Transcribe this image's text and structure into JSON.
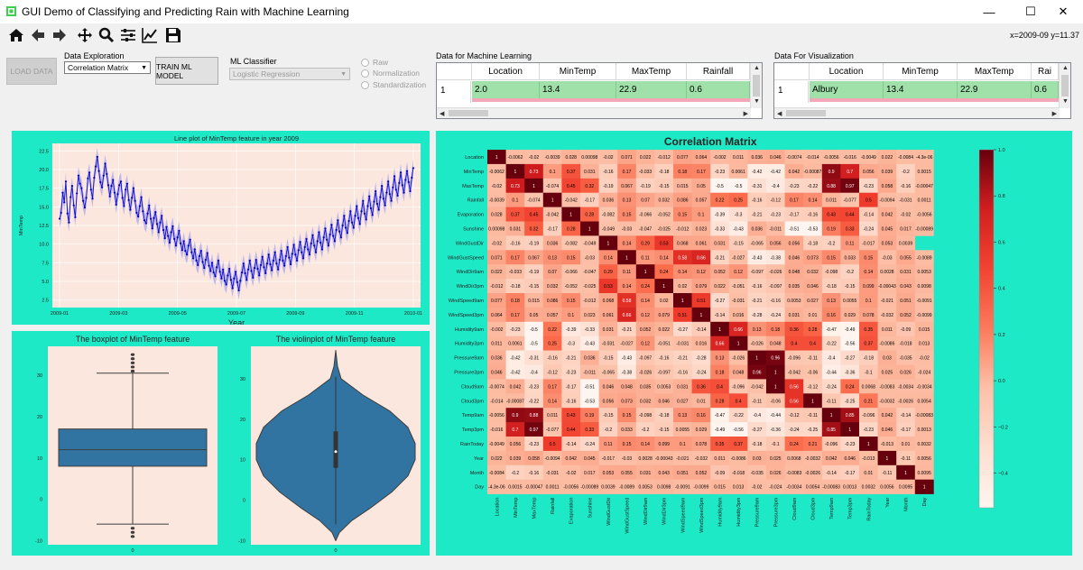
{
  "window": {
    "title": "GUI Demo of Classifying and Predicting Rain with Machine Learning",
    "minimize": "—",
    "maximize": "☐",
    "close": "✕"
  },
  "toolbar": {
    "items": [
      {
        "name": "home-icon",
        "glyph": "⌂"
      },
      {
        "name": "back-icon",
        "glyph": "←"
      },
      {
        "name": "forward-icon",
        "glyph": "→"
      },
      {
        "name": "pan-icon",
        "glyph": "✥"
      },
      {
        "name": "zoom-icon",
        "glyph": "⚲"
      },
      {
        "name": "configure-subplots-icon",
        "glyph": "☰"
      },
      {
        "name": "edit-axis-icon",
        "glyph": "📈"
      },
      {
        "name": "save-icon",
        "glyph": "💾"
      }
    ],
    "coords": "x=2009-09 y=11.37"
  },
  "controls": {
    "load_data": "LOAD DATA",
    "data_exploration_label": "Data Exploration",
    "data_exploration_value": "Correlation Matrix",
    "train_button": "TRAIN ML MODEL",
    "ml_classifier_label": "ML Classifier",
    "ml_classifier_value": "Logistic Regression",
    "radios": [
      "Raw",
      "Normalization",
      "Standardization"
    ]
  },
  "ml_table": {
    "title": "Data for Machine Learning",
    "columns": [
      "Location",
      "MinTemp",
      "MaxTemp",
      "Rainfall"
    ],
    "row_header": "1",
    "row": [
      "2.0",
      "13.4",
      "22.9",
      "0.6"
    ]
  },
  "vis_table": {
    "title": "Data For Visualization",
    "columns": [
      "Location",
      "MinTemp",
      "MaxTemp",
      "Rai"
    ],
    "row_header": "1",
    "row": [
      "Albury",
      "13.4",
      "22.9",
      "0.6"
    ]
  },
  "line_chart_data": {
    "type": "line",
    "title": "Line plot of MinTemp feature in year 2009",
    "xlabel": "Year",
    "ylabel": "MinTemp",
    "xticks": [
      "2009-01",
      "2009-03",
      "2009-05",
      "2009-07",
      "2009-09",
      "2009-11",
      "2010-01"
    ],
    "yticks": [
      "2.5",
      "5.0",
      "7.5",
      "10.0",
      "12.5",
      "15.0",
      "17.5",
      "20.0",
      "22.5"
    ],
    "ylim": [
      1.5,
      23.5
    ],
    "values": [
      13.4,
      14.2,
      16.9,
      15.6,
      18.4,
      14.1,
      12.9,
      16.3,
      17.8,
      15.2,
      13.6,
      16.8,
      19.2,
      18.1,
      17.5,
      15.8,
      14.9,
      16.2,
      18.8,
      19.6,
      17.3,
      16.1,
      18.9,
      20.4,
      21.7,
      19.8,
      18.3,
      17.6,
      19.2,
      20.8,
      19.4,
      17.9,
      16.4,
      17.8,
      18.6,
      16.9,
      15.3,
      16.7,
      17.9,
      18.4,
      16.2,
      15.1,
      17.3,
      18.1,
      15.9,
      14.6,
      16.2,
      17.5,
      15.8,
      14.2,
      13.7,
      15.1,
      16.3,
      14.4,
      13.2,
      12.8,
      14.1,
      15.2,
      13.4,
      12.1,
      13.5,
      14.3,
      12.7,
      11.6,
      12.9,
      13.8,
      11.9,
      10.8,
      12.3,
      11.1,
      10.2,
      11.6,
      12.4,
      10.7,
      9.8,
      10.9,
      11.8,
      10.1,
      9.2,
      10.4,
      9.1,
      8.6,
      9.8,
      10.6,
      8.9,
      8.1,
      9.3,
      7.8,
      7.2,
      8.4,
      9.1,
      7.6,
      6.8,
      7.9,
      8.8,
      7.1,
      6.4,
      7.5,
      6.2,
      5.7,
      6.9,
      7.8,
      6.3,
      5.4,
      6.6,
      5.1,
      4.6,
      5.8,
      6.7,
      5.2,
      4.1,
      5.4,
      6.3,
      4.9,
      3.8,
      5.1,
      6.2,
      7.4,
      6.1,
      5.2,
      6.6,
      7.8,
      6.4,
      5.5,
      6.8,
      7.9,
      6.7,
      5.8,
      7.2,
      8.3,
      6.9,
      6.1,
      7.4,
      8.6,
      7.3,
      6.5,
      7.8,
      8.9,
      7.4,
      6.6,
      7.9,
      9.1,
      7.8,
      7.1,
      8.4,
      9.6,
      8.2,
      7.3,
      8.7,
      9.9,
      8.6,
      7.8,
      9.2,
      10.3,
      8.9,
      8.1,
      9.6,
      10.7,
      9.3,
      8.6,
      10.1,
      11.2,
      9.8,
      8.9,
      10.4,
      11.6,
      10.2,
      9.3,
      10.9,
      12.1,
      10.6,
      9.8,
      11.3,
      12.6,
      11.1,
      10.4,
      11.9,
      13.2,
      11.7,
      10.9,
      12.5,
      13.8,
      12.2,
      11.5,
      13.1,
      14.4,
      12.9,
      12.2,
      13.8,
      15.1,
      13.5,
      12.7,
      14.4,
      15.8,
      14.1,
      13.3,
      15.1,
      16.4,
      14.8,
      13.9,
      15.7,
      17.1,
      15.4,
      14.6,
      16.3,
      17.8,
      16.1,
      15.2,
      16.9,
      18.4,
      16.7,
      15.8,
      17.6,
      19.1,
      17.3,
      16.5,
      18.2,
      19.6,
      17.9,
      16.9,
      18.6,
      19.8,
      18.3,
      17.1,
      18.9,
      20.2
    ]
  },
  "box_chart_data": {
    "type": "box",
    "title": "The boxplot of MinTemp feature",
    "xticks": [
      "0"
    ],
    "yticks": [
      "-10",
      "0",
      "10",
      "20",
      "30"
    ],
    "ylim": [
      -11,
      37
    ],
    "whisker_low": -6,
    "q1": 8,
    "median": 12,
    "q3": 17,
    "whisker_high": 30.5,
    "outliers": [
      31,
      32,
      33,
      34,
      35,
      -7,
      -8,
      -9
    ]
  },
  "violin_chart_data": {
    "type": "violin",
    "title": "The violinplot of MinTemp feature",
    "xticks": [
      "0"
    ],
    "yticks": [
      "-10",
      "0",
      "10",
      "20",
      "30"
    ],
    "ylim": [
      -11,
      38
    ]
  },
  "corr_chart_data": {
    "type": "heatmap",
    "title": "Correlation Matrix",
    "labels": [
      "Location",
      "MinTemp",
      "MaxTemp",
      "Rainfall",
      "Evaporation",
      "Sunshine",
      "WindGustDir",
      "WindGustSpeed",
      "WindDir9am",
      "WindDir3pm",
      "WindSpeed9am",
      "WindSpeed3pm",
      "Humidity9am",
      "Humidity3pm",
      "Pressure9am",
      "Pressure3pm",
      "Cloud9am",
      "Cloud3pm",
      "Temp9am",
      "Temp3pm",
      "RainToday",
      "Year",
      "Month",
      "Day"
    ],
    "colorbar_ticks": [
      "1.0",
      "0.8",
      "0.6",
      "0.4",
      "0.2",
      "0.0",
      "−0.2",
      "−0.4"
    ],
    "matrix": [
      [
        "1",
        "-0.0062",
        "-0.02",
        "-0.0039",
        "0.028",
        "0.00098",
        "-0.02",
        "0.071",
        "0.022",
        "-0.012",
        "0.077",
        "0.064",
        "-0.002",
        "0.011",
        "0.036",
        "0.046",
        "-0.0074",
        "-0.014",
        "-0.0056",
        "-0.016",
        "-0.0049",
        "0.022",
        "-0.0084",
        "-4.3e-06"
      ],
      [
        "-0.0062",
        "1",
        "0.73",
        "0.1",
        "0.37",
        "0.031",
        "-0.16",
        "0.17",
        "-0.033",
        "-0.18",
        "0.18",
        "0.17",
        "-0.23",
        "0.0061",
        "-0.42",
        "-0.42",
        "0.042",
        "-0.00087",
        "0.9",
        "0.7",
        "0.056",
        "0.039",
        "-0.2",
        "0.0015"
      ],
      [
        "-0.02",
        "0.73",
        "1",
        "-0.074",
        "0.45",
        "0.32",
        "-0.19",
        "0.067",
        "-0.19",
        "-0.15",
        "0.015",
        "0.05",
        "-0.5",
        "-0.5",
        "-0.31",
        "-0.4",
        "-0.23",
        "-0.22",
        "0.88",
        "0.97",
        "-0.23",
        "0.058",
        "-0.16",
        "-0.00047"
      ],
      [
        "-0.0039",
        "0.1",
        "-0.074",
        "1",
        "-0.042",
        "-0.17",
        "0.036",
        "0.13",
        "0.07",
        "0.032",
        "0.086",
        "0.057",
        "0.22",
        "0.25",
        "-0.16",
        "-0.12",
        "0.17",
        "0.14",
        "0.011",
        "-0.077",
        "0.5",
        "-0.0094",
        "-0.031",
        "0.0011"
      ],
      [
        "0.028",
        "0.37",
        "0.45",
        "-0.042",
        "1",
        "0.28",
        "-0.082",
        "0.15",
        "-0.066",
        "-0.052",
        "0.15",
        "0.1",
        "-0.39",
        "-0.3",
        "-0.21",
        "-0.23",
        "-0.17",
        "-0.16",
        "0.43",
        "0.44",
        "-0.14",
        "0.042",
        "-0.02",
        "-0.0056"
      ],
      [
        "0.00098",
        "0.031",
        "0.32",
        "-0.17",
        "0.28",
        "1",
        "-0.049",
        "-0.03",
        "-0.047",
        "-0.025",
        "-0.012",
        "0.023",
        "-0.33",
        "-0.43",
        "0.036",
        "-0.011",
        "-0.51",
        "-0.53",
        "0.19",
        "0.33",
        "-0.24",
        "0.045",
        "0.017",
        "-0.00089"
      ],
      [
        "-0.02",
        "-0.16",
        "-0.19",
        "0.036",
        "-0.082",
        "-0.049",
        "1",
        "0.14",
        "0.29",
        "0.53",
        "0.068",
        "0.061",
        "0.031",
        "-0.15",
        "-0.065",
        "0.056",
        "0.056",
        "-0.18",
        "-0.2",
        "0.11",
        "-0.017",
        "0.053",
        "0.0039"
      ],
      [
        "0.071",
        "0.17",
        "0.067",
        "0.13",
        "0.15",
        "-0.03",
        "0.14",
        "1",
        "0.11",
        "0.14",
        "0.58",
        "0.66",
        "-0.21",
        "-0.027",
        "-0.43",
        "-0.38",
        "0.046",
        "0.073",
        "0.15",
        "0.033",
        "0.15",
        "-0.03",
        "0.055",
        "-0.0089"
      ],
      [
        "0.022",
        "-0.033",
        "-0.19",
        "0.07",
        "-0.066",
        "-0.047",
        "0.29",
        "0.11",
        "1",
        "0.24",
        "0.14",
        "0.12",
        "0.052",
        "0.12",
        "-0.097",
        "-0.026",
        "0.048",
        "0.032",
        "-0.098",
        "-0.2",
        "0.14",
        "0.0028",
        "0.031",
        "0.0053"
      ],
      [
        "-0.012",
        "-0.18",
        "-0.15",
        "0.032",
        "-0.052",
        "-0.025",
        "0.53",
        "0.14",
        "0.24",
        "1",
        "0.02",
        "0.079",
        "0.022",
        "-0.051",
        "-0.16",
        "-0.097",
        "0.035",
        "0.046",
        "-0.18",
        "-0.15",
        "0.099",
        "-0.00043",
        "0.043",
        "0.0098"
      ],
      [
        "0.077",
        "0.18",
        "0.015",
        "0.086",
        "0.15",
        "-0.012",
        "0.068",
        "0.58",
        "0.14",
        "0.02",
        "1",
        "0.51",
        "-0.27",
        "-0.031",
        "-0.21",
        "-0.16",
        "0.0053",
        "0.027",
        "0.13",
        "0.0055",
        "0.1",
        "-0.021",
        "0.051",
        "-0.0091"
      ],
      [
        "0.064",
        "0.17",
        "0.05",
        "0.057",
        "0.1",
        "0.023",
        "0.061",
        "0.66",
        "0.12",
        "0.079",
        "0.51",
        "1",
        "-0.14",
        "0.016",
        "-0.28",
        "-0.24",
        "0.031",
        "0.01",
        "0.16",
        "0.029",
        "0.078",
        "-0.032",
        "0.052",
        "-0.0099"
      ],
      [
        "-0.002",
        "-0.23",
        "-0.5",
        "0.22",
        "-0.39",
        "-0.33",
        "0.031",
        "-0.21",
        "0.052",
        "0.022",
        "-0.27",
        "-0.14",
        "1",
        "0.66",
        "0.13",
        "0.18",
        "0.36",
        "0.28",
        "-0.47",
        "-0.49",
        "0.35",
        "0.011",
        "-0.09",
        "0.015"
      ],
      [
        "0.011",
        "0.0061",
        "-0.5",
        "0.25",
        "-0.3",
        "-0.43",
        "-0.031",
        "-0.027",
        "0.12",
        "-0.051",
        "-0.031",
        "0.016",
        "0.66",
        "1",
        "-0.026",
        "0.048",
        "0.4",
        "0.4",
        "-0.22",
        "-0.56",
        "0.37",
        "-0.0086",
        "-0.018",
        "0.013"
      ],
      [
        "0.036",
        "-0.42",
        "-0.31",
        "-0.16",
        "-0.21",
        "0.036",
        "-0.15",
        "-0.43",
        "-0.097",
        "-0.16",
        "-0.21",
        "-0.28",
        "0.13",
        "-0.026",
        "1",
        "0.96",
        "-0.096",
        "-0.11",
        "-0.4",
        "-0.27",
        "-0.18",
        "0.03",
        "-0.035",
        "-0.02"
      ],
      [
        "0.046",
        "-0.42",
        "-0.4",
        "-0.12",
        "-0.23",
        "-0.011",
        "-0.065",
        "-0.38",
        "-0.026",
        "-0.097",
        "-0.16",
        "-0.24",
        "0.18",
        "0.048",
        "0.96",
        "1",
        "-0.042",
        "-0.06",
        "-0.44",
        "-0.36",
        "-0.1",
        "0.025",
        "0.026",
        "-0.024"
      ],
      [
        "-0.0074",
        "0.042",
        "-0.23",
        "0.17",
        "-0.17",
        "-0.51",
        "0.046",
        "0.048",
        "0.035",
        "0.0053",
        "0.031",
        "0.36",
        "0.4",
        "-0.096",
        "-0.042",
        "1",
        "0.56",
        "-0.12",
        "-0.24",
        "0.24",
        "0.0068",
        "-0.0083",
        "-0.0034",
        "-0.0034"
      ],
      [
        "-0.014",
        "-0.00087",
        "-0.22",
        "0.14",
        "-0.16",
        "-0.53",
        "0.056",
        "0.073",
        "0.032",
        "0.046",
        "0.027",
        "0.01",
        "0.28",
        "0.4",
        "-0.11",
        "-0.06",
        "0.56",
        "1",
        "-0.11",
        "-0.25",
        "0.21",
        "-0.0032",
        "-0.0026",
        "0.0054"
      ],
      [
        "-0.0056",
        "0.9",
        "0.88",
        "0.011",
        "0.43",
        "0.19",
        "-0.15",
        "0.15",
        "-0.098",
        "-0.18",
        "0.13",
        "0.16",
        "-0.47",
        "-0.22",
        "-0.4",
        "-0.44",
        "-0.12",
        "-0.11",
        "1",
        "0.85",
        "-0.096",
        "0.042",
        "-0.14",
        "-0.00083"
      ],
      [
        "-0.016",
        "0.7",
        "0.97",
        "-0.077",
        "0.44",
        "0.33",
        "-0.2",
        "0.033",
        "-0.2",
        "-0.15",
        "0.0055",
        "0.029",
        "-0.49",
        "-0.56",
        "-0.27",
        "-0.36",
        "-0.24",
        "-0.25",
        "0.85",
        "1",
        "-0.23",
        "0.046",
        "-0.17",
        "0.0013"
      ],
      [
        "-0.0049",
        "0.056",
        "-0.23",
        "0.5",
        "-0.14",
        "-0.24",
        "0.11",
        "0.15",
        "0.14",
        "0.099",
        "0.1",
        "0.078",
        "0.35",
        "0.37",
        "-0.18",
        "-0.1",
        "0.24",
        "0.21",
        "-0.096",
        "-0.23",
        "1",
        "-0.013",
        "0.01",
        "0.0032"
      ],
      [
        "0.022",
        "0.039",
        "0.058",
        "-0.0094",
        "0.042",
        "0.045",
        "-0.017",
        "-0.03",
        "0.0028",
        "-0.00043",
        "-0.021",
        "-0.032",
        "0.011",
        "-0.0086",
        "0.03",
        "0.025",
        "0.0068",
        "-0.0032",
        "0.042",
        "0.046",
        "-0.013",
        "1",
        "-0.11",
        "0.0056"
      ],
      [
        "-0.0084",
        "-0.2",
        "-0.16",
        "-0.031",
        "-0.02",
        "0.017",
        "0.053",
        "0.055",
        "0.031",
        "0.043",
        "0.051",
        "0.052",
        "-0.09",
        "-0.018",
        "-0.035",
        "0.026",
        "-0.0083",
        "-0.0026",
        "-0.14",
        "-0.17",
        "0.01",
        "-0.11",
        "1",
        "0.0095"
      ],
      [
        "-4.3e-06",
        "0.0015",
        "-0.00047",
        "0.0011",
        "-0.0056",
        "-0.00089",
        "0.0039",
        "-0.0089",
        "0.0053",
        "0.0098",
        "-0.0091",
        "-0.0099",
        "0.015",
        "0.013",
        "-0.02",
        "-0.024",
        "-0.0034",
        "0.0054",
        "-0.00083",
        "0.0013",
        "0.0032",
        "0.0056",
        "0.0095",
        "1"
      ]
    ]
  }
}
